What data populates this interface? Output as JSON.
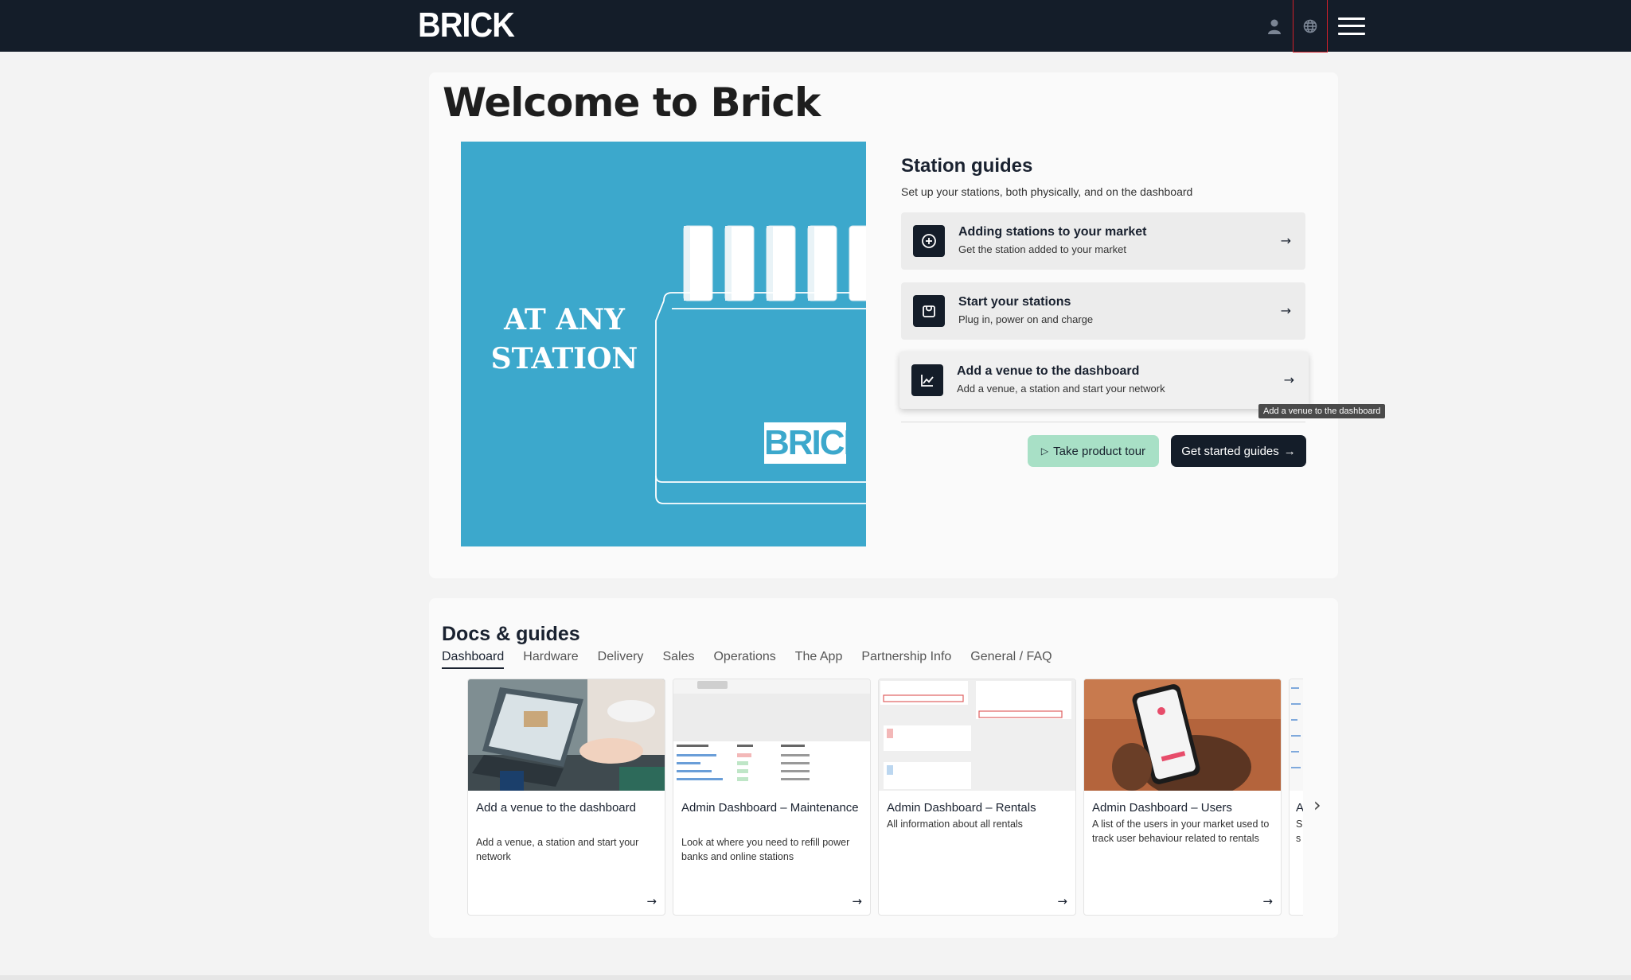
{
  "brand": {
    "name": "BRICK"
  },
  "header": {
    "icons": [
      "user-icon",
      "globe-icon",
      "hamburger-menu-icon"
    ]
  },
  "main": {
    "title": "Welcome to Brick",
    "hero": {
      "slogan_line1": "AT ANY",
      "slogan_line2": "STATION",
      "badge": "BRICK"
    }
  },
  "station_guides": {
    "title": "Station guides",
    "subtitle": "Set up your stations, both physically, and on the dashboard",
    "items": [
      {
        "title": "Adding stations to your market",
        "subtitle": "Get the station added to your market",
        "icon": "plus-circle-icon"
      },
      {
        "title": "Start your stations",
        "subtitle": "Plug in, power on and charge",
        "icon": "power-bank-icon"
      },
      {
        "title": "Add a venue to the dashboard",
        "subtitle": "Add a venue, a station and start your network",
        "icon": "chart-line-icon"
      }
    ],
    "tooltip": "Add a venue to the dashboard",
    "tour_button": "Take product tour",
    "guides_button": "Get started guides"
  },
  "docs": {
    "title": "Docs & guides",
    "tabs": [
      "Dashboard",
      "Hardware",
      "Delivery",
      "Sales",
      "Operations",
      "The App",
      "Partnership Info",
      "General / FAQ"
    ],
    "active_tab": "Dashboard",
    "cards": [
      {
        "title": "Add a venue to the dashboard",
        "subtitle": "Add a venue, a station and start your network"
      },
      {
        "title": "Admin Dashboard – Maintenance",
        "subtitle": "Look at where you need to refill power banks and online stations"
      },
      {
        "title": "Admin Dashboard – Rentals",
        "subtitle": "All information about all rentals"
      },
      {
        "title": "Admin Dashboard – Users",
        "subtitle": "A list of the users in your market used to track user behaviour related to rentals"
      }
    ],
    "partial_card": {
      "title_initial": "A",
      "subtitle_initials": "S s"
    }
  },
  "colors": {
    "topbar": "#141d29",
    "hero_blue": "#3ca8cc",
    "tour_green": "#a8e0c6",
    "dark_button": "#141d29"
  }
}
